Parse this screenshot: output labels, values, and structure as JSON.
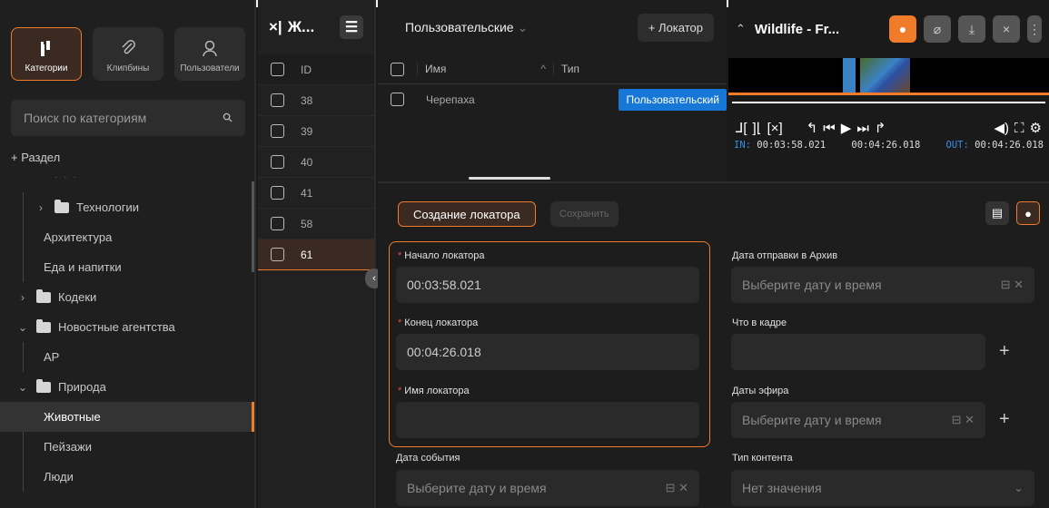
{
  "sidebar": {
    "modes": [
      {
        "label": "Категории",
        "icon": "categories-icon",
        "active": true
      },
      {
        "label": "Клипбины",
        "icon": "paperclip-icon",
        "active": false
      },
      {
        "label": "Пользователи",
        "icon": "user-icon",
        "active": false
      }
    ],
    "search_placeholder": "Поиск по категориям",
    "add_section": "+ Раздел",
    "tree": [
      {
        "label": "Технологии",
        "level": 1,
        "chevron": "›",
        "folder": true
      },
      {
        "label": "Архитектура",
        "level": 1,
        "chevron": "",
        "folder": false
      },
      {
        "label": "Еда и напитки",
        "level": 1,
        "chevron": "",
        "folder": false
      },
      {
        "label": "Кодеки",
        "level": 0,
        "chevron": "›",
        "folder": true
      },
      {
        "label": "Новостные агентства",
        "level": 0,
        "chevron": "⌄",
        "folder": true
      },
      {
        "label": "AP",
        "level": 1,
        "chevron": "",
        "folder": false
      },
      {
        "label": "Природа",
        "level": 0,
        "chevron": "⌄",
        "folder": true
      },
      {
        "label": "Животные",
        "level": 1,
        "chevron": "",
        "folder": false,
        "selected": true
      },
      {
        "label": "Пейзажи",
        "level": 1,
        "chevron": "",
        "folder": false
      },
      {
        "label": "Люди",
        "level": 1,
        "chevron": "",
        "folder": false
      }
    ]
  },
  "idpanel": {
    "title": "Ж...",
    "col_header": "ID",
    "rows": [
      "38",
      "39",
      "40",
      "41",
      "58",
      "61"
    ],
    "selected": "61"
  },
  "locators": {
    "filter": "Пользовательские",
    "add_button": "+ Локатор",
    "col_name": "Имя",
    "col_type": "Тип",
    "rows": [
      {
        "name": "Черепаха",
        "type": "Пользовательский"
      }
    ]
  },
  "player": {
    "title": "Wildlife - Fr...",
    "in_label": "IN:",
    "in_time": "00:03:58.021",
    "mid_time": "00:04:26.018",
    "out_label": "OUT:",
    "out_time": "00:04:26.018"
  },
  "form": {
    "create_button": "Создание локатора",
    "save_button": "Сохранить",
    "start_label": "Начало локатора",
    "start_value": "00:03:58.021",
    "end_label": "Конец локатора",
    "end_value": "00:04:26.018",
    "name_label": "Имя локатора",
    "name_value": "",
    "event_date_label": "Дата события",
    "event_date_placeholder": "Выберите дату и время",
    "archive_date_label": "Дата отправки в Архив",
    "archive_date_placeholder": "Выберите дату и время",
    "in_frame_label": "Что в кадре",
    "air_dates_label": "Даты эфира",
    "air_dates_placeholder": "Выберите дату и время",
    "content_type_label": "Тип контента",
    "content_type_value": "Нет значения"
  },
  "colors": {
    "accent": "#f07c2a",
    "badge": "#1677d6"
  }
}
